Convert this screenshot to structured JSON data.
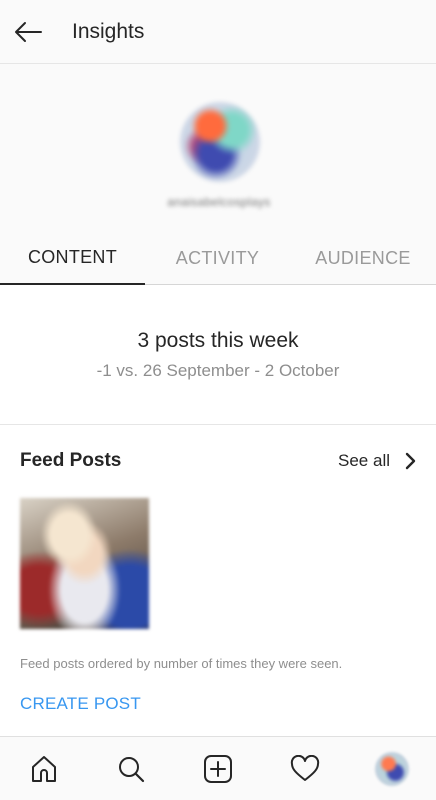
{
  "header": {
    "title": "Insights",
    "back_icon": "arrow-left-icon"
  },
  "profile": {
    "username": "anaisabelcosplays"
  },
  "tabs": [
    {
      "label": "CONTENT",
      "active": true
    },
    {
      "label": "ACTIVITY",
      "active": false
    },
    {
      "label": "AUDIENCE",
      "active": false
    }
  ],
  "summary": {
    "posts_count_text": "3 posts this week",
    "comparison_text": "-1 vs. 26 September - 2 October"
  },
  "feed_posts": {
    "title": "Feed Posts",
    "see_all_label": "See all",
    "note": "Feed posts ordered by number of times they were seen.",
    "create_post_label": "CREATE POST"
  },
  "bottom_nav": {
    "items": [
      "home-icon",
      "search-icon",
      "add-post-icon",
      "heart-icon",
      "profile-avatar"
    ]
  },
  "colors": {
    "accent_link": "#3897f0",
    "text_primary": "#262626",
    "text_secondary": "#8e8e8e",
    "header_bg": "#fafafa"
  }
}
